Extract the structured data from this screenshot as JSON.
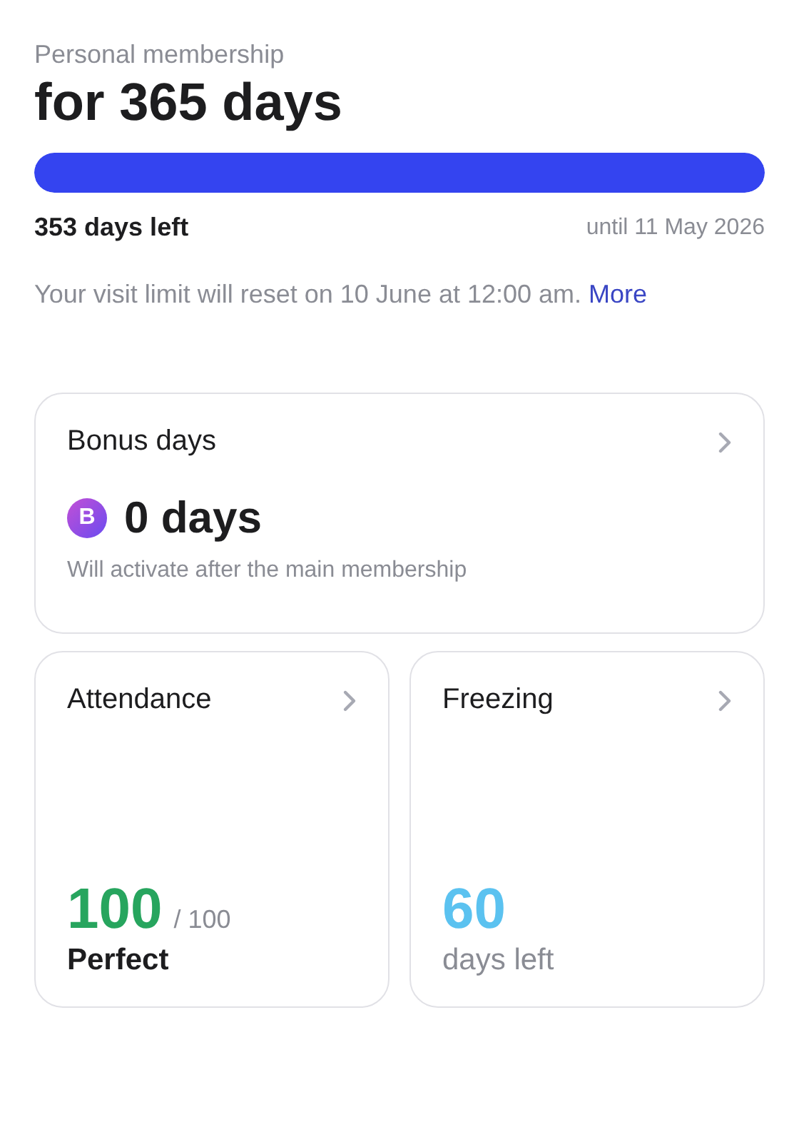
{
  "membership": {
    "label": "Personal membership",
    "title": "for 365 days",
    "level": 1,
    "days_left": "353 days left",
    "until": "until 11 May 2026"
  },
  "notice": {
    "text": "Your visit limit will reset on 10 June at 12:00 am.",
    "link": "More"
  },
  "bonus_card": {
    "title": "Bonus days",
    "badge": "B",
    "value": "0 days",
    "note": "Will activate after the main membership"
  },
  "stat_cards": [
    {
      "kind": "attendance",
      "title": "Attendance",
      "value": "100",
      "total": "/ 100",
      "caption": "Perfect"
    },
    {
      "kind": "freezing",
      "title": "Freezing",
      "value": "60",
      "caption": "days left"
    }
  ]
}
